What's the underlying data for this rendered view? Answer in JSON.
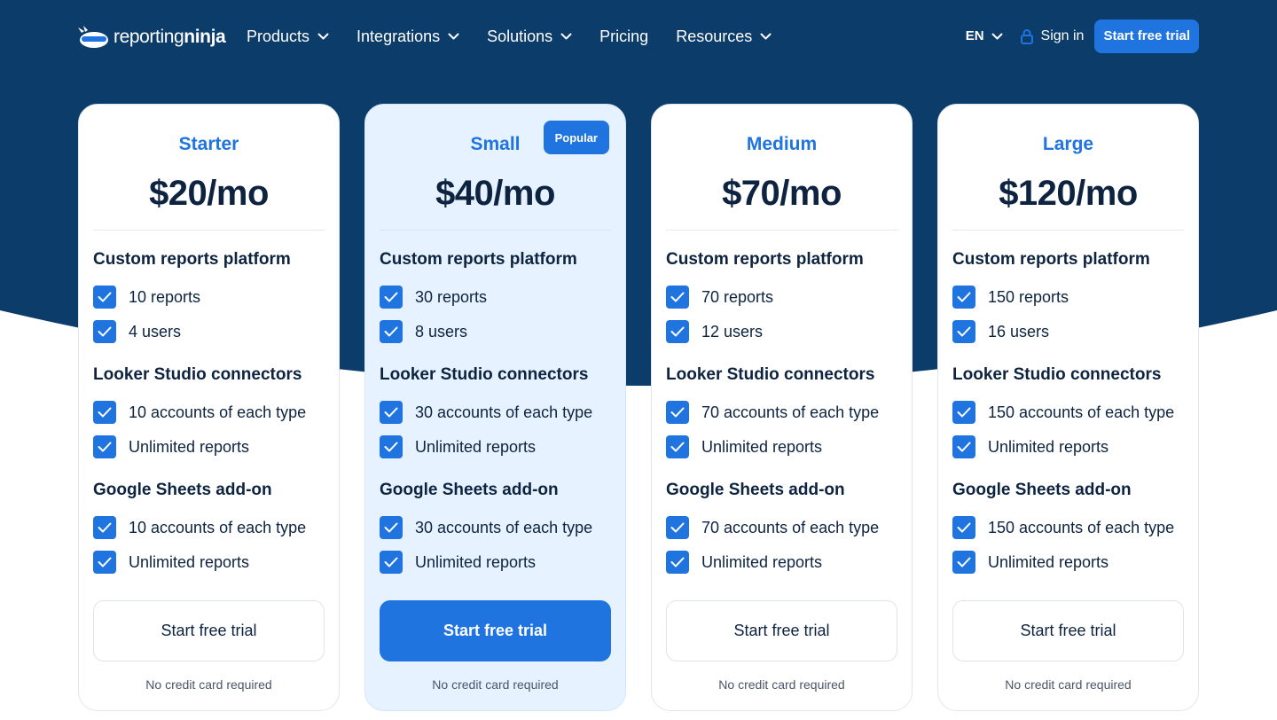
{
  "brand": {
    "logo_regular": "reporting",
    "logo_bold": "ninja",
    "icon": "ninja-logo-icon"
  },
  "nav": {
    "items": [
      {
        "label": "Products",
        "has_dropdown": true
      },
      {
        "label": "Integrations",
        "has_dropdown": true
      },
      {
        "label": "Solutions",
        "has_dropdown": true
      },
      {
        "label": "Pricing",
        "has_dropdown": false
      },
      {
        "label": "Resources",
        "has_dropdown": true
      }
    ],
    "language": "EN",
    "sign_in": "Sign in",
    "cta": "Start free trial"
  },
  "colors": {
    "hero_background": "#0c3c6a",
    "accent": "#1f74e0",
    "popular_card": "#e6f2ff",
    "text": "#0d2340"
  },
  "plans": [
    {
      "name": "Starter",
      "price": "$20/mo",
      "popular": false,
      "sections": [
        {
          "title": "Custom reports platform",
          "features": [
            "10 reports",
            "4 users"
          ]
        },
        {
          "title": "Looker Studio connectors",
          "features": [
            "10 accounts of each type",
            "Unlimited reports"
          ]
        },
        {
          "title": "Google Sheets add-on",
          "features": [
            "10 accounts of each type",
            "Unlimited reports"
          ]
        }
      ],
      "cta": "Start free trial",
      "note": "No credit card required"
    },
    {
      "name": "Small",
      "price": "$40/mo",
      "popular": true,
      "badge": "Popular",
      "sections": [
        {
          "title": "Custom reports platform",
          "features": [
            "30 reports",
            "8 users"
          ]
        },
        {
          "title": "Looker Studio connectors",
          "features": [
            "30 accounts of each type",
            "Unlimited reports"
          ]
        },
        {
          "title": "Google Sheets add-on",
          "features": [
            "30 accounts of each type",
            "Unlimited reports"
          ]
        }
      ],
      "cta": "Start free trial",
      "note": "No credit card required"
    },
    {
      "name": "Medium",
      "price": "$70/mo",
      "popular": false,
      "sections": [
        {
          "title": "Custom reports platform",
          "features": [
            "70 reports",
            "12 users"
          ]
        },
        {
          "title": "Looker Studio connectors",
          "features": [
            "70 accounts of each type",
            "Unlimited reports"
          ]
        },
        {
          "title": "Google Sheets add-on",
          "features": [
            "70 accounts of each type",
            "Unlimited reports"
          ]
        }
      ],
      "cta": "Start free trial",
      "note": "No credit card required"
    },
    {
      "name": "Large",
      "price": "$120/mo",
      "popular": false,
      "sections": [
        {
          "title": "Custom reports platform",
          "features": [
            "150 reports",
            "16 users"
          ]
        },
        {
          "title": "Looker Studio connectors",
          "features": [
            "150 accounts of each type",
            "Unlimited reports"
          ]
        },
        {
          "title": "Google Sheets add-on",
          "features": [
            "150 accounts of each type",
            "Unlimited reports"
          ]
        }
      ],
      "cta": "Start free trial",
      "note": "No credit card required"
    }
  ]
}
